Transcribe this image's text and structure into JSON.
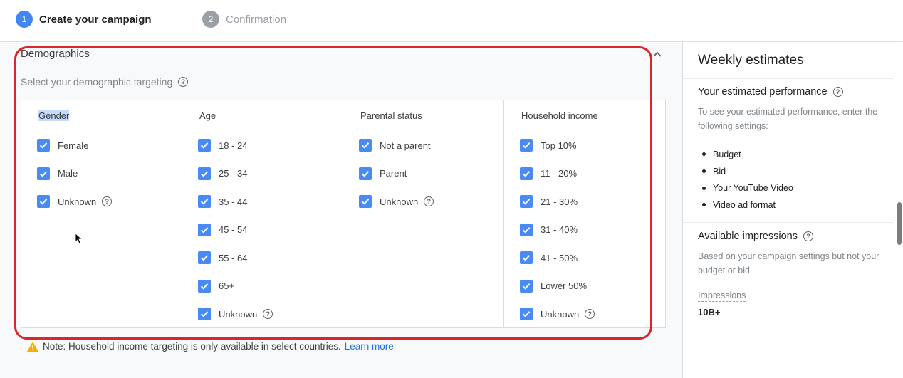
{
  "stepper": {
    "step1": {
      "number": "1",
      "label": "Create your campaign"
    },
    "step2": {
      "number": "2",
      "label": "Confirmation"
    }
  },
  "demographics": {
    "title": "Demographics",
    "subtitle": "Select your demographic targeting",
    "columns": [
      {
        "title": "Gender",
        "options": [
          "Female",
          "Male",
          "Unknown"
        ]
      },
      {
        "title": "Age",
        "options": [
          "18 - 24",
          "25 - 34",
          "35 - 44",
          "45 - 54",
          "55 - 64",
          "65+",
          "Unknown"
        ]
      },
      {
        "title": "Parental status",
        "options": [
          "Not a parent",
          "Parent",
          "Unknown"
        ]
      },
      {
        "title": "Household income",
        "options": [
          "Top 10%",
          "11 - 20%",
          "21 - 30%",
          "31 - 40%",
          "41 - 50%",
          "Lower 50%",
          "Unknown"
        ]
      }
    ],
    "note": "Note: Household income targeting is only available in select countries.",
    "learn_more": "Learn more"
  },
  "sidebar": {
    "title": "Weekly estimates",
    "performance_title": "Your estimated performance",
    "performance_desc": "To see your estimated performance, enter the following settings:",
    "settings": [
      "Budget",
      "Bid",
      "Your YouTube Video",
      "Video ad format"
    ],
    "impressions_title": "Available impressions",
    "impressions_desc": "Based on your campaign settings but not your budget or bid",
    "impressions_label": "Impressions",
    "impressions_value": "10B+"
  },
  "colors": {
    "accent": "#4285f4",
    "checkbox": "#4a8af4",
    "highlight": "#d9262d",
    "link": "#1a73e8"
  }
}
